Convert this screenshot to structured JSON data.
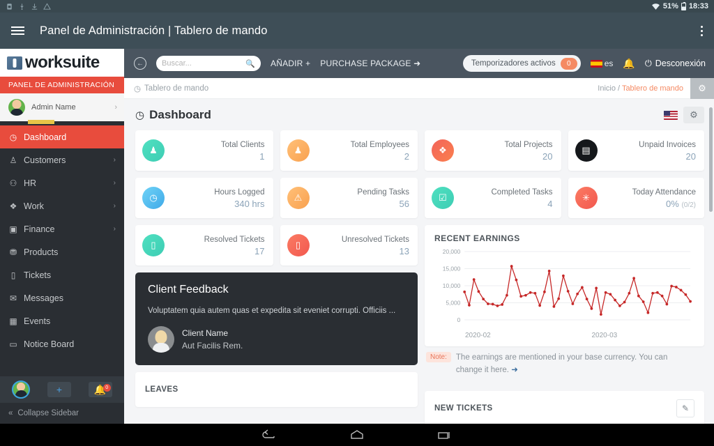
{
  "android": {
    "status": {
      "left_icons": [
        "sim-icon",
        "usb-icon",
        "download-icon",
        "warning-icon"
      ],
      "battery_percent": "51%",
      "time": "18:33",
      "wifi_icon": "wifi-icon",
      "battery_icon": "battery-icon"
    },
    "nav": {
      "back": "back-icon",
      "home": "home-icon",
      "recents": "recents-icon"
    }
  },
  "app_bar": {
    "menu_icon": "hamburger-icon",
    "title": "Panel de Administración | Tablero de mando",
    "overflow_icon": "kebab-menu-icon"
  },
  "sidebar": {
    "brand": "worksuite",
    "admin_banner": "PANEL DE ADMINISTRACIÓN",
    "profile": {
      "name": "Admin Name",
      "chevron": "›"
    },
    "items": [
      {
        "label": "Dashboard",
        "icon": "dashboard-icon",
        "glyph": "◷",
        "active": true,
        "chevron": ""
      },
      {
        "label": "Customers",
        "icon": "customers-icon",
        "glyph": "♗",
        "active": false,
        "chevron": "›"
      },
      {
        "label": "HR",
        "icon": "hr-icon",
        "glyph": "👤",
        "active": false,
        "chevron": "›"
      },
      {
        "label": "Work",
        "icon": "work-icon",
        "glyph": "❖",
        "active": false,
        "chevron": "›"
      },
      {
        "label": "Finance",
        "icon": "finance-icon",
        "glyph": "▣",
        "active": false,
        "chevron": "›"
      },
      {
        "label": "Products",
        "icon": "products-icon",
        "glyph": "🛒",
        "active": false,
        "chevron": ""
      },
      {
        "label": "Tickets",
        "icon": "tickets-icon",
        "glyph": "🎫",
        "active": false,
        "chevron": ""
      },
      {
        "label": "Messages",
        "icon": "messages-icon",
        "glyph": "✉",
        "active": false,
        "chevron": ""
      },
      {
        "label": "Events",
        "icon": "events-icon",
        "glyph": "▦",
        "active": false,
        "chevron": ""
      },
      {
        "label": "Notice Board",
        "icon": "notice-board-icon",
        "glyph": "▭",
        "active": false,
        "chevron": ""
      }
    ],
    "actions": {
      "avatar": "user-avatar",
      "add_label": "+",
      "bell_badge": "0"
    },
    "collapse_label": "Collapse Sidebar",
    "collapse_icon": "«"
  },
  "topnav": {
    "back_icon": "circle-back-arrow-icon",
    "search_placeholder": "Buscar...",
    "search_value": "",
    "search_icon": "search-icon",
    "add_label": "AÑADIR +",
    "purchase_label": "PURCHASE PACKAGE ➜",
    "timers_label": "Temporizadores activos",
    "timers_count": "0",
    "language": "es",
    "flag_icon": "spain-flag-icon",
    "bell_icon": "notification-bell-icon",
    "logout_label": "Desconexión",
    "power_icon": "power-icon"
  },
  "breadcrumb": {
    "current_page": "Tablero de mando",
    "page_icon": "dashboard-icon",
    "home": "Inicio",
    "separator": "/",
    "active": "Tablero de mando",
    "gear_icon": "settings-gear-icon"
  },
  "page": {
    "title": "Dashboard",
    "title_icon": "dashboard-icon",
    "flag_icon": "us-flag-icon",
    "gear_icon": "settings-gear-icon"
  },
  "stats": [
    {
      "label": "Total Clients",
      "value": "1",
      "sub": "",
      "icon": "clients-icon",
      "glyph": "♟",
      "color": "#3ed6b8"
    },
    {
      "label": "Total Employees",
      "value": "2",
      "sub": "",
      "icon": "employees-icon",
      "glyph": "♟",
      "color": "#f9ab55"
    },
    {
      "label": "Total Projects",
      "value": "20",
      "sub": "",
      "icon": "projects-icon",
      "glyph": "❖",
      "color": "#f2645a"
    },
    {
      "label": "Unpaid Invoices",
      "value": "20",
      "sub": "",
      "icon": "invoices-icon",
      "glyph": "▤",
      "color": "#1d1d1d"
    },
    {
      "label": "Hours Logged",
      "value": "340 hrs",
      "sub": "",
      "icon": "clock-icon",
      "glyph": "◷",
      "color": "#4db8f0"
    },
    {
      "label": "Pending Tasks",
      "value": "56",
      "sub": "",
      "icon": "pending-icon",
      "glyph": "⚠",
      "color": "#f9ab55"
    },
    {
      "label": "Completed Tasks",
      "value": "4",
      "sub": "",
      "icon": "completed-icon",
      "glyph": "☑",
      "color": "#3ed6b8"
    },
    {
      "label": "Today Attendance",
      "value": "0%",
      "sub": "(0/2)",
      "icon": "attendance-icon",
      "glyph": "✳",
      "color": "#f2645a"
    },
    {
      "label": "Resolved Tickets",
      "value": "17",
      "sub": "",
      "icon": "resolved-icon",
      "glyph": "🎫",
      "color": "#3ed6b8"
    },
    {
      "label": "Unresolved Tickets",
      "value": "13",
      "sub": "",
      "icon": "unresolved-icon",
      "glyph": "🎫",
      "color": "#f2645a"
    }
  ],
  "feedback": {
    "title": "Client Feedback",
    "text": "Voluptatem quia autem quas et expedita sit eveniet corrupti. Officiis ...",
    "client_name": "Client Name",
    "client_sub": "Aut Facilis Rem.",
    "avatar": "client-avatar"
  },
  "note": {
    "badge": "Note:",
    "text": "The earnings are mentioned in your base currency. You can change it here. ",
    "arrow": "➜"
  },
  "bottom_panels": [
    {
      "title": "LEAVES",
      "action": ""
    },
    {
      "title": "NEW TICKETS",
      "action": "edit-icon"
    }
  ],
  "chart_data": {
    "type": "line",
    "title": "RECENT EARNINGS",
    "xlabel": "",
    "ylabel": "",
    "ylim": [
      0,
      20000
    ],
    "yticks": [
      0,
      5000,
      10000,
      15000,
      20000
    ],
    "ytick_labels": [
      "0",
      "5,000",
      "10,000",
      "15,000",
      "20,000"
    ],
    "xtick_labels": [
      "2020-02",
      "2020-03"
    ],
    "grid": true,
    "legend": "none",
    "line_color": "#c62828",
    "marker_color": "#c62828",
    "series": [
      {
        "name": "Earnings",
        "values": [
          8200,
          4300,
          11800,
          8300,
          6100,
          4700,
          4600,
          4100,
          4500,
          7200,
          15700,
          11700,
          6900,
          7200,
          8000,
          7800,
          4200,
          8200,
          14300,
          3900,
          6200,
          12900,
          8400,
          4700,
          7600,
          9500,
          6100,
          3300,
          9300,
          1600,
          8000,
          7500,
          5800,
          4100,
          5200,
          7800,
          12200,
          7000,
          5300,
          2100,
          7800,
          8000,
          7000,
          4600,
          9900,
          9600,
          8700,
          7400,
          5400
        ]
      }
    ]
  }
}
